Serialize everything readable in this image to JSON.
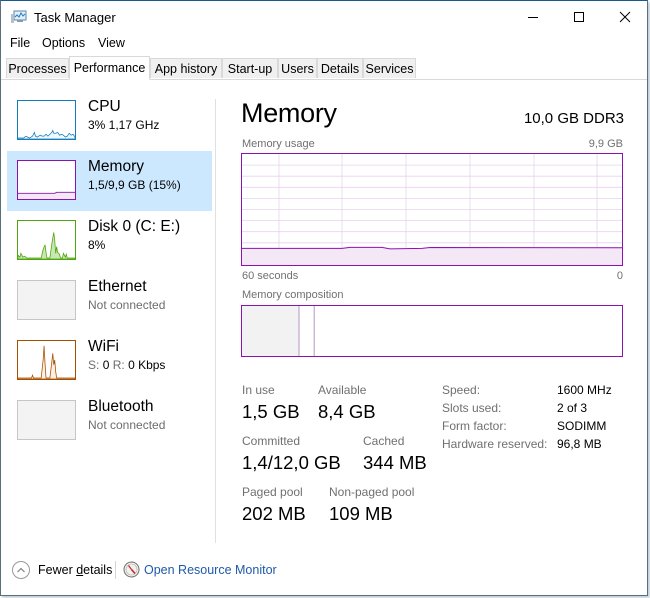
{
  "window": {
    "title": "Task Manager",
    "controls": {
      "minimize": "–",
      "maximize": "☐",
      "close": "✕"
    }
  },
  "menu": [
    "File",
    "Options",
    "View"
  ],
  "tabs": [
    {
      "label": "Processes",
      "active": false
    },
    {
      "label": "Performance",
      "active": true
    },
    {
      "label": "App history",
      "active": false
    },
    {
      "label": "Start-up",
      "active": false
    },
    {
      "label": "Users",
      "active": false
    },
    {
      "label": "Details",
      "active": false
    },
    {
      "label": "Services",
      "active": false
    }
  ],
  "sidebar": {
    "items": [
      {
        "name": "CPU",
        "sub": "3% 1,17 GHz",
        "color": "#117dbb",
        "active": false,
        "connected": true
      },
      {
        "name": "Memory",
        "sub": "1,5/9,9 GB (15%)",
        "color": "#8b12ae",
        "active": true,
        "connected": true
      },
      {
        "name": "Disk 0 (C: E:)",
        "sub": "8%",
        "color": "#4da60c",
        "active": false,
        "connected": true
      },
      {
        "name": "Ethernet",
        "sub": "Not connected",
        "color": "#c6c6c6",
        "active": false,
        "connected": false
      },
      {
        "name": "WiFi",
        "sub_s": "S:",
        "sub_s_val": "0",
        "sub_r": "R:",
        "sub_r_val": "0 Kbps",
        "color": "#a74f01",
        "active": false,
        "connected": true
      },
      {
        "name": "Bluetooth",
        "sub": "Not connected",
        "color": "#c6c6c6",
        "active": false,
        "connected": false
      }
    ]
  },
  "main": {
    "title": "Memory",
    "capacity": "10,0 GB DDR3",
    "usage_label": "Memory usage",
    "usage_max": "9,9 GB",
    "axis_left": "60 seconds",
    "axis_right": "0",
    "composition_label": "Memory composition",
    "accent": "#8b12ae",
    "usage_fraction": 0.15,
    "composition": {
      "in_use_fraction": 0.15,
      "modified_fraction": 0.01,
      "standby_fraction": 0.03
    },
    "stats": {
      "in_use": {
        "label": "In use",
        "value": "1,5 GB"
      },
      "available": {
        "label": "Available",
        "value": "8,4 GB"
      },
      "committed": {
        "label": "Committed",
        "value": "1,4/12,0 GB"
      },
      "cached": {
        "label": "Cached",
        "value": "344 MB"
      },
      "paged_pool": {
        "label": "Paged pool",
        "value": "202 MB"
      },
      "non_paged_pool": {
        "label": "Non-paged pool",
        "value": "109 MB"
      }
    },
    "specs": [
      {
        "label": "Speed:",
        "value": "1600 MHz"
      },
      {
        "label": "Slots used:",
        "value": "2 of 3"
      },
      {
        "label": "Form factor:",
        "value": "SODIMM"
      },
      {
        "label": "Hardware reserved:",
        "value": "96,8 MB"
      }
    ]
  },
  "footer": {
    "fewer_details": "Fewer details",
    "open_resource_monitor": "Open Resource Monitor"
  }
}
